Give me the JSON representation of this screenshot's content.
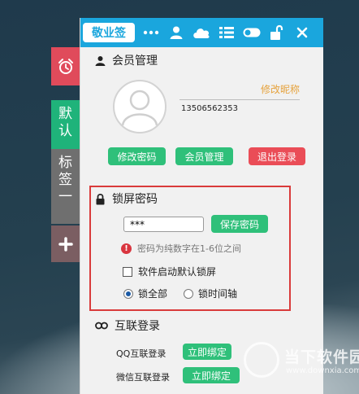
{
  "side_tabs": {
    "default_label": "默认",
    "tag1_label": "标签一"
  },
  "topbar": {
    "brand": "敬业签",
    "icons": [
      "more-icon",
      "user-icon",
      "cloud-icon",
      "list-icon",
      "toggle-icon",
      "unlock-icon",
      "close-icon"
    ]
  },
  "member": {
    "title": "会员管理",
    "nickname_link": "修改昵称",
    "phone": "13506562353",
    "change_password": "修改密码",
    "member_manage": "会员管理",
    "logout": "退出登录"
  },
  "lock": {
    "title": "锁屏密码",
    "password_value": "***",
    "save_button": "保存密码",
    "hint": "密码为纯数字在1-6位之间",
    "startup_lock_label": "软件启动默认锁屏",
    "startup_lock_checked": false,
    "radio_all": "锁全部",
    "radio_timeline": "锁时间轴",
    "selected_radio": "锁全部"
  },
  "interconnect": {
    "title": "互联登录",
    "qq_label": "QQ互联登录",
    "qq_button": "立即绑定",
    "wechat_label": "微信互联登录",
    "wechat_button": "立即绑定"
  },
  "watermark": {
    "name": "当下软件园",
    "url": "www.downxia.com"
  },
  "colors": {
    "accent": "#1aa6dd",
    "green": "#2fc07a",
    "red": "#ea4d57",
    "frame": "#d93b3b"
  }
}
